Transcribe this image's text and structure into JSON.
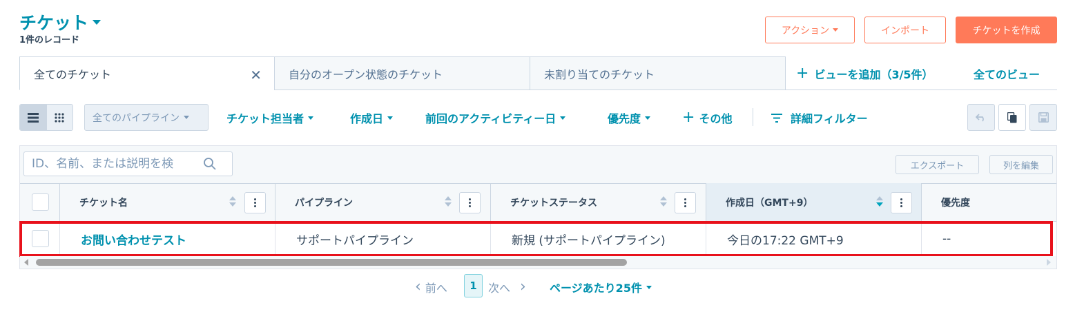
{
  "header": {
    "title": "チケット",
    "record_count": "1件のレコード",
    "actions_label": "アクション",
    "import_label": "インポート",
    "create_label": "チケットを作成"
  },
  "views": {
    "tabs": [
      {
        "label": "全てのチケット",
        "active": true
      },
      {
        "label": "自分のオープン状態のチケット",
        "active": false
      },
      {
        "label": "未割り当てのチケット",
        "active": false
      }
    ],
    "add_view_label": "ビューを追加（3/5件）",
    "all_views_label": "全てのビュー"
  },
  "filters": {
    "pipeline": "全てのパイプライン",
    "owner": "チケット担当者",
    "created": "作成日",
    "last_activity": "前回のアクティビティー日",
    "priority": "優先度",
    "more": "その他",
    "advanced": "詳細フィルター"
  },
  "table": {
    "search_placeholder": "ID、名前、または説明を検",
    "export_label": "エクスポート",
    "edit_columns_label": "列を編集",
    "columns": [
      "チケット名",
      "パイプライン",
      "チケットステータス",
      "作成日（GMT+9）",
      "優先度"
    ],
    "rows": [
      {
        "name": "お問い合わせテスト",
        "pipeline": "サポートパイプライン",
        "status": "新規 (サポートパイプライン)",
        "created": "今日の17:22 GMT+9",
        "priority": "--"
      }
    ]
  },
  "pagination": {
    "prev": "前へ",
    "page": "1",
    "next": "次へ",
    "per_page": "ページあたり25件"
  },
  "colors": {
    "accent": "#0091ae",
    "primary_button": "#ff7a59",
    "highlight_border": "#e8111b"
  }
}
